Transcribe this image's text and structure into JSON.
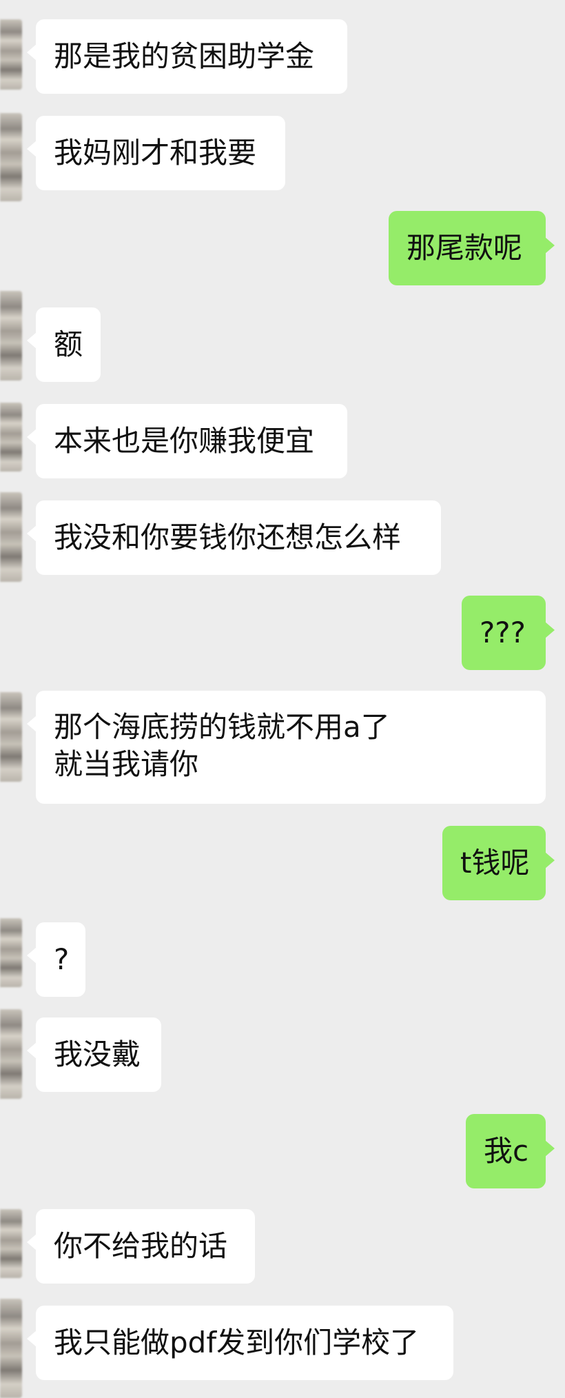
{
  "colors": {
    "background": "#ededed",
    "incoming_bubble": "#ffffff",
    "outgoing_bubble": "#95ec69",
    "text": "#111111"
  },
  "messages": [
    {
      "side": "in",
      "text": "那是我的贫困助学金"
    },
    {
      "side": "in",
      "text": "我妈刚才和我要"
    },
    {
      "side": "out",
      "text": "那尾款呢"
    },
    {
      "side": "in",
      "text": "额"
    },
    {
      "side": "in",
      "text": "本来也是你赚我便宜"
    },
    {
      "side": "in",
      "text": "我没和你要钱你还想怎么样"
    },
    {
      "side": "out",
      "text": "???"
    },
    {
      "side": "in",
      "text": "那个海底捞的钱就不用a了  就当我请你"
    },
    {
      "side": "out",
      "text": "t钱呢"
    },
    {
      "side": "in",
      "text": "?"
    },
    {
      "side": "in",
      "text": "我没戴"
    },
    {
      "side": "out",
      "text": "我c"
    },
    {
      "side": "in",
      "text": "你不给我的话"
    },
    {
      "side": "in",
      "text": "我只能做pdf发到你们学校了"
    }
  ]
}
